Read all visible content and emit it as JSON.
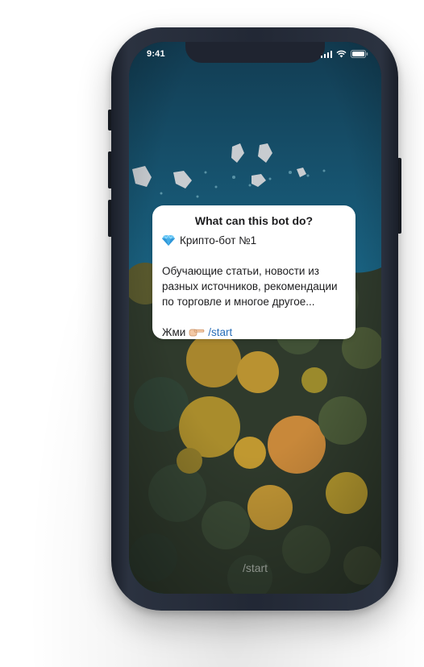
{
  "status_bar": {
    "time": "9:41",
    "icons": [
      "signal-icon",
      "wifi-icon",
      "battery-icon"
    ]
  },
  "bot_info_card": {
    "title": "What can this bot do?",
    "bot_name": "Крипто-бот №1",
    "description_lines": [
      "Обучающие статьи, новости из",
      "разных источников, рекомендации",
      "по торговле и многое другое..."
    ],
    "cta_text": "Жми",
    "cta_command": "/start",
    "link_color": "#2a6fb8",
    "icons": [
      "gem-icon",
      "pointing-hand-icon"
    ]
  },
  "bottom_bar": {
    "command_text": "/start"
  },
  "colors": {
    "phone_body": "#222835",
    "card_background": "#ffffff",
    "water": "#1e6f8f"
  }
}
